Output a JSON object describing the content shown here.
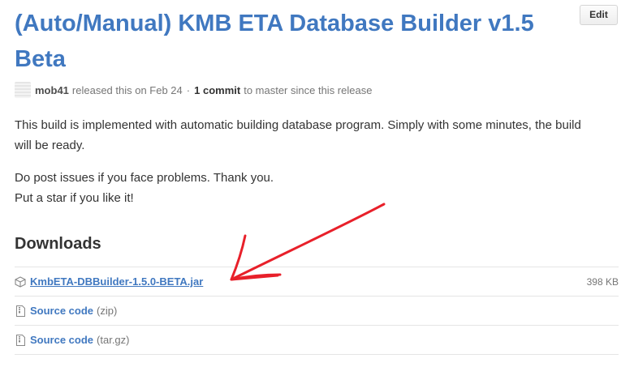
{
  "release": {
    "title": "(Auto/Manual) KMB ETA Database Builder v1.5 Beta",
    "edit_label": "Edit",
    "author": "mob41",
    "released_text": "released this on Feb 24",
    "separator": "·",
    "commits": "1 commit",
    "commits_suffix": "to master since this release"
  },
  "description": {
    "paragraph1": "This build is implemented with automatic building database program. Simply with some minutes, the build will be ready.",
    "paragraph2_line1": "Do post issues if you face problems. Thank you.",
    "paragraph2_line2": "Put a star if you like it!"
  },
  "downloads": {
    "heading": "Downloads",
    "items": [
      {
        "name": "KmbETA-DBBuilder-1.5.0-BETA.jar",
        "ext": "",
        "size": "398 KB",
        "icon": "package-icon"
      },
      {
        "name": "Source code",
        "ext": "(zip)",
        "size": "",
        "icon": "file-zip-icon"
      },
      {
        "name": "Source code",
        "ext": "(tar.gz)",
        "size": "",
        "icon": "file-zip-icon"
      }
    ]
  },
  "colors": {
    "link": "#4078c0",
    "annotation_arrow": "#e8202a"
  }
}
